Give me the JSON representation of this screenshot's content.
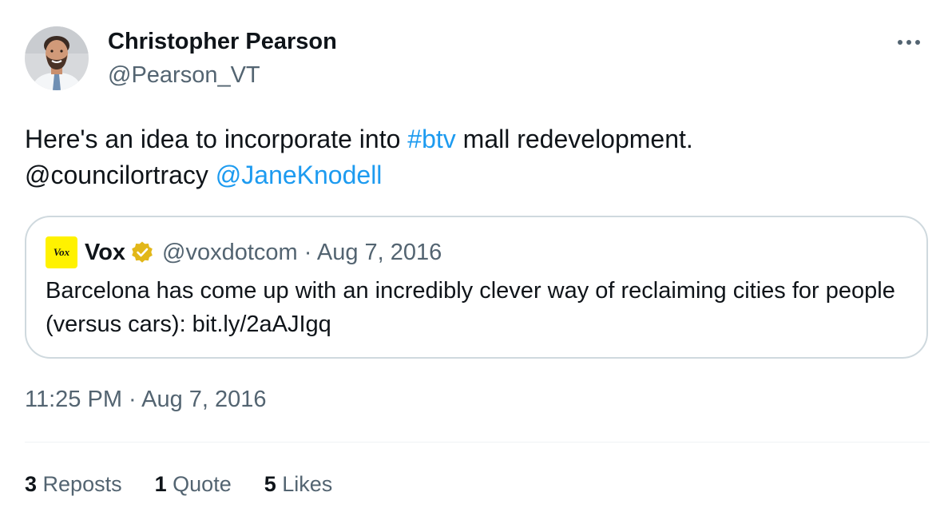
{
  "tweet": {
    "author": {
      "name": "Christopher Pearson",
      "handle": "@Pearson_VT"
    },
    "text": {
      "part1": "Here's an idea to incorporate into ",
      "hashtag": "#btv",
      "part2": " mall redevelopment.",
      "mention1": "@councilortracy",
      "mention2": "@JaneKnodell"
    },
    "timestamp": "11:25 PM · Aug 7, 2016"
  },
  "quote": {
    "logo_text": "Vox",
    "name": "Vox",
    "meta": "@voxdotcom · Aug 7, 2016",
    "text": "Barcelona has come up with an incredibly clever way of reclaiming cities for people (versus cars): bit.ly/2aAJIgq"
  },
  "stats": {
    "reposts_count": "3",
    "reposts_label": "Reposts",
    "quotes_count": "1",
    "quotes_label": "Quote",
    "likes_count": "5",
    "likes_label": "Likes"
  },
  "icons": {
    "more": "more-horizontal-icon",
    "verified": "verified-badge-icon"
  },
  "colors": {
    "link": "#1d9bf0",
    "secondary_text": "#536471",
    "primary_text": "#0f1419",
    "border": "#cfd9de",
    "verified_gold": "#e2b719",
    "vox_yellow": "#fff200"
  }
}
